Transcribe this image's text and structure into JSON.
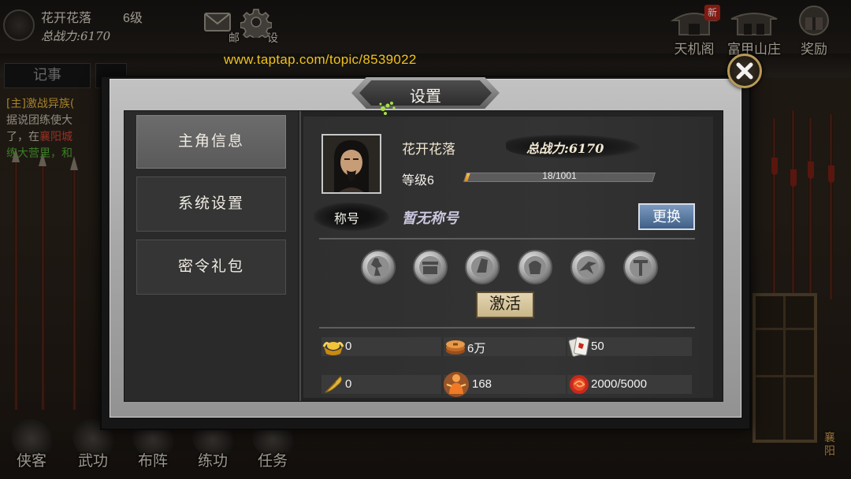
{
  "hud": {
    "player_name": "花开花落",
    "player_level": "6级",
    "player_power": "总战力:6170",
    "mail_label": "邮",
    "settings_label": "设"
  },
  "top_menu": [
    {
      "label": "天机阁",
      "badge": "新",
      "icon": "pavilion-icon"
    },
    {
      "label": "富甲山庄",
      "icon": "manor-icon"
    },
    {
      "label": "奖励",
      "icon": "reward-icon"
    }
  ],
  "watermark": "www.taptap.com/topic/8539022",
  "quest": {
    "tab": "记事",
    "title": "[主]激战异族(",
    "line1": "据说团练使大",
    "line2_prefix": "了，在",
    "line2_place": "襄阳城",
    "line3": "练大营里，和"
  },
  "bottom_nav": [
    {
      "label": "侠客"
    },
    {
      "label": "武功"
    },
    {
      "label": "布阵"
    },
    {
      "label": "练功"
    },
    {
      "label": "任务"
    }
  ],
  "location": "襄阳",
  "modal": {
    "title": "设置",
    "menu": [
      {
        "label": "主角信息",
        "selected": true
      },
      {
        "label": "系统设置",
        "selected": false
      },
      {
        "label": "密令礼包",
        "selected": false
      }
    ],
    "profile": {
      "name": "花开花落",
      "power": "总战力:6170",
      "level": "等级6",
      "exp": {
        "current": 18,
        "max": 1001,
        "text": "18/1001"
      },
      "title_label": "称号",
      "title_value": "暂无称号",
      "change_button": "更换"
    },
    "badges": [
      "emblem-1-icon",
      "emblem-2-icon",
      "emblem-3-icon",
      "emblem-4-icon",
      "emblem-5-icon",
      "emblem-6-icon"
    ],
    "activate_button": "激活",
    "resources": [
      {
        "icon": "gold-ingot-icon",
        "value": "0"
      },
      {
        "icon": "copper-coin-icon",
        "value": "6万"
      },
      {
        "icon": "card-icon",
        "value": "50"
      },
      {
        "icon": "quill-icon",
        "value": "0"
      },
      {
        "icon": "hero-icon",
        "value": "168"
      },
      {
        "icon": "red-orb-icon",
        "value": "2000/5000"
      }
    ]
  },
  "colors": {
    "watermark": "#f4c51c",
    "exp_fill": "#f0a030",
    "change_button": "#5a7aa4",
    "activate_button": "#d8c8a0",
    "menu_selected": "#636363"
  }
}
